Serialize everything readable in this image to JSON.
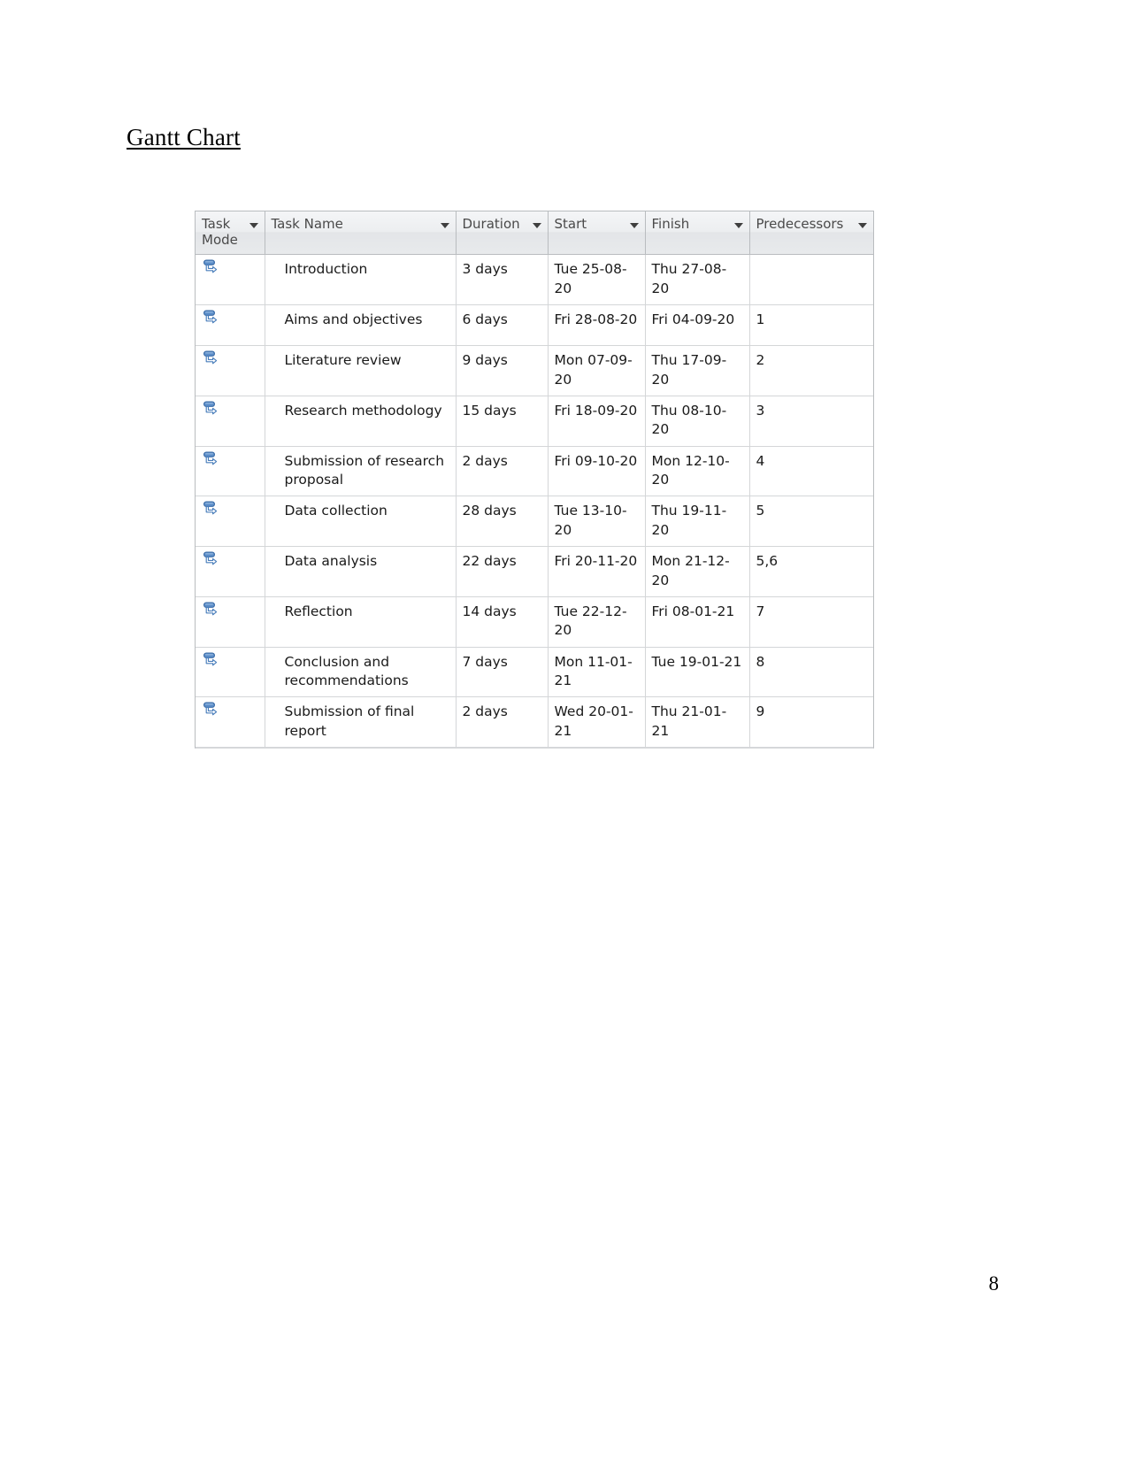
{
  "document": {
    "heading": "Gantt Chart",
    "page_number": "8"
  },
  "project_table": {
    "columns": [
      {
        "key": "task_mode",
        "label": "Task Mode",
        "has_filter": true
      },
      {
        "key": "task_name",
        "label": "Task Name",
        "has_filter": true
      },
      {
        "key": "duration",
        "label": "Duration",
        "has_filter": true
      },
      {
        "key": "start",
        "label": "Start",
        "has_filter": true
      },
      {
        "key": "finish",
        "label": "Finish",
        "has_filter": true
      },
      {
        "key": "predecessors",
        "label": "Predecessors",
        "has_filter": true
      }
    ],
    "task_mode_icon": "auto-scheduled-icon",
    "rows": [
      {
        "task_mode": "Auto Scheduled",
        "task_name": "Introduction",
        "duration": "3 days",
        "start": "Tue 25-08-20",
        "finish": "Thu 27-08-20",
        "predecessors": ""
      },
      {
        "task_mode": "Auto Scheduled",
        "task_name": "Aims and objectives",
        "duration": "6 days",
        "start": "Fri 28-08-20",
        "finish": "Fri 04-09-20",
        "predecessors": "1"
      },
      {
        "task_mode": "Auto Scheduled",
        "task_name": "Literature review",
        "duration": "9 days",
        "start": "Mon 07-09-20",
        "finish": "Thu 17-09-20",
        "predecessors": "2"
      },
      {
        "task_mode": "Auto Scheduled",
        "task_name": "Research methodology",
        "duration": "15 days",
        "start": "Fri 18-09-20",
        "finish": "Thu 08-10-20",
        "predecessors": "3"
      },
      {
        "task_mode": "Auto Scheduled",
        "task_name": "Submission of research proposal",
        "duration": "2 days",
        "start": "Fri 09-10-20",
        "finish": "Mon 12-10-20",
        "predecessors": "4"
      },
      {
        "task_mode": "Auto Scheduled",
        "task_name": "Data collection",
        "duration": "28 days",
        "start": "Tue 13-10-20",
        "finish": "Thu 19-11-20",
        "predecessors": "5"
      },
      {
        "task_mode": "Auto Scheduled",
        "task_name": "Data analysis",
        "duration": "22 days",
        "start": "Fri 20-11-20",
        "finish": "Mon 21-12-20",
        "predecessors": "5,6"
      },
      {
        "task_mode": "Auto Scheduled",
        "task_name": "Reflection",
        "duration": "14 days",
        "start": "Tue 22-12-20",
        "finish": "Fri 08-01-21",
        "predecessors": "7"
      },
      {
        "task_mode": "Auto Scheduled",
        "task_name": "Conclusion and recommendations",
        "duration": "7 days",
        "start": "Mon 11-01-21",
        "finish": "Tue 19-01-21",
        "predecessors": "8"
      },
      {
        "task_mode": "Auto Scheduled",
        "task_name": "Submission of final report",
        "duration": "2 days",
        "start": "Wed 20-01-21",
        "finish": "Thu 21-01-21",
        "predecessors": "9"
      }
    ]
  },
  "colors": {
    "header_background": "#e8eaec",
    "header_text": "#4a4a4a",
    "grid_line": "#d4d6d8",
    "icon_blue": "#4a7ebb",
    "body_text": "#1a1a1a"
  }
}
